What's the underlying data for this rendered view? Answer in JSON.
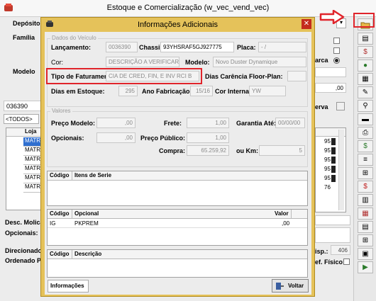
{
  "main_window": {
    "title": "Estoque e Comercialização (w_vec_vend_vec)",
    "labels": {
      "deposito": "Depósito:",
      "familia": "Família",
      "modelo": "Modelo",
      "todos_tab": "<TODOS>",
      "loja_col": "Loja",
      "desc_molica": "Desc. Molica",
      "opcionais": "Opcionais:",
      "direcionados": "Direcionados",
      "ordenado_po": "Ordenado Po",
      "marca_partial": "arca",
      "reserva_partial": "erva",
      "disp_label": "isp.:",
      "disp_value": "406",
      "fisico_label": "ef. Físico:",
      "right_zero_value": ",00"
    },
    "search_value": "036390",
    "loja_rows": [
      "MATRI",
      "MATRI",
      "MATRI",
      "MATRI",
      "MATRI",
      "MATRI"
    ],
    "right_col_values": [
      "95",
      "95",
      "95",
      "95",
      "95",
      "76"
    ]
  },
  "dialog": {
    "title": "Informações Adicionais",
    "veiculo": {
      "group_title": "Dados do Veículo",
      "lancamento_label": "Lançamento:",
      "lancamento_value": "0036390",
      "chassi_label": "Chassi:",
      "chassi_value": "93YHSRAF5GJ927775",
      "placa_label": "Placa:",
      "placa_value": "-  /",
      "cor_label": "Cor:",
      "cor_value": "DESCRIÇÃO A VERIFICAR",
      "modelo_label": "Modelo:",
      "modelo_value": "Novo Duster Dynamique",
      "tipo_fat_label": "Tipo de Faturamento:",
      "tipo_fat_value": "CIA DE CRED, FIN, E INV RCI B",
      "dias_carencia_label": "Dias Carência Floor-Plan:",
      "dias_carencia_value": "",
      "dias_estoque_label": "Dias em Estoque:",
      "dias_estoque_value": "295",
      "ano_fab_label": "Ano Fabricação:",
      "ano_fab_value": "15/16",
      "cor_interna_label": "Cor Interna:",
      "cor_interna_value": "YW"
    },
    "valores": {
      "group_title": "Valores",
      "preco_modelo_label": "Preço Modelo:",
      "preco_modelo_value": ",00",
      "frete_label": "Frete:",
      "frete_value": "1,00",
      "garantia_label": "Garantia Até:",
      "garantia_value": "00/00/00",
      "opcionais_label": "Opcionais:",
      "opcionais_value": ",00",
      "preco_publico_label": "Preço Público:",
      "preco_publico_value": "1,00",
      "compra_label": "Compra:",
      "compra_value": "65.259,92",
      "km_label": "ou Km:",
      "km_value": "5"
    },
    "serie_grid": {
      "col_codigo": "Código",
      "col_itens": "Itens de Serie"
    },
    "opcional_grid": {
      "col_codigo": "Código",
      "col_opcional": "Opcional",
      "col_valor": "Valor",
      "rows": [
        {
          "codigo": "IG",
          "opcional": "PKPREM",
          "valor": ",00"
        }
      ]
    },
    "descricao_grid": {
      "col_codigo": "Código",
      "col_descricao": "Descrição"
    },
    "info_button": "Informações",
    "voltar_button": "Voltar"
  },
  "colors": {
    "dialog_frame": "#e5c25a",
    "highlight_red": "#e0242b"
  }
}
